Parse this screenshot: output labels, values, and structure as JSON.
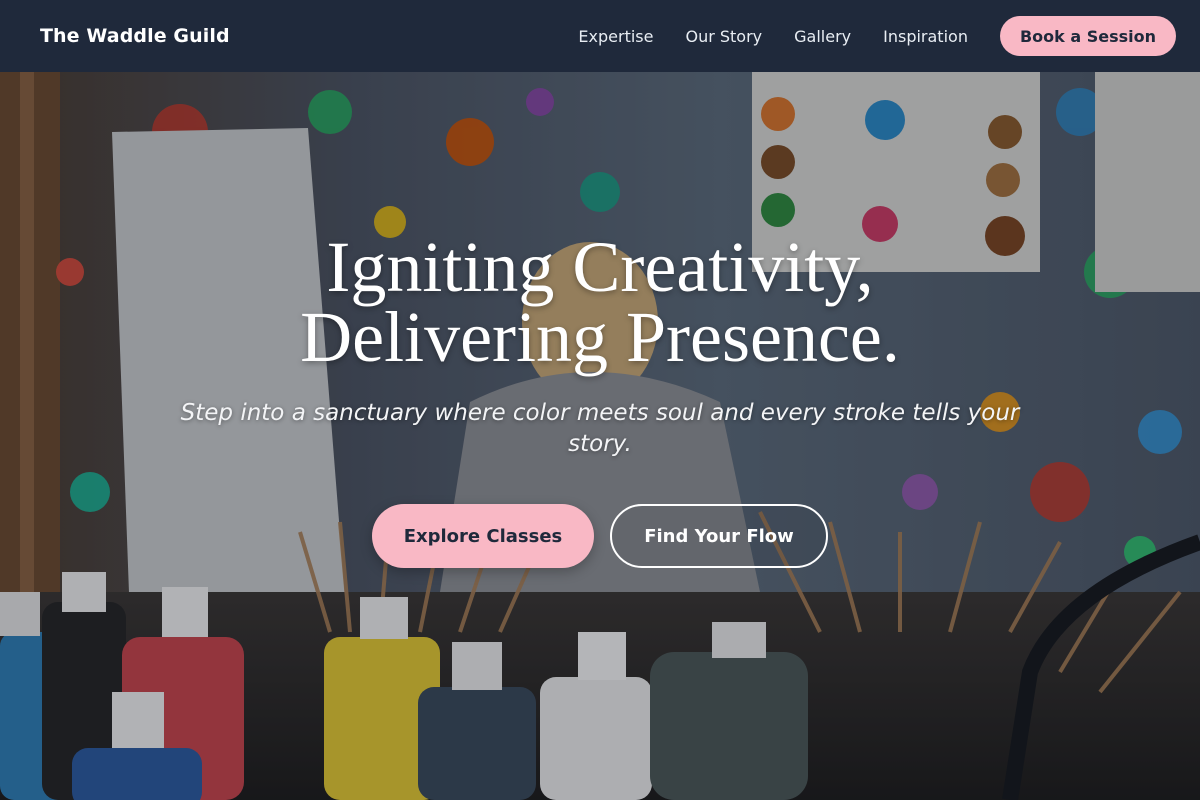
{
  "nav": {
    "brand": "The Waddle Guild",
    "links": [
      {
        "label": "Expertise"
      },
      {
        "label": "Our Story"
      },
      {
        "label": "Gallery"
      },
      {
        "label": "Inspiration"
      }
    ],
    "cta_label": "Book a Session"
  },
  "hero": {
    "title_line1": "Igniting Creativity,",
    "title_line2": "Delivering Presence.",
    "subtitle": "Step into a sanctuary where color meets soul and every stroke tells your story.",
    "primary_button": "Explore Classes",
    "secondary_button": "Find Your Flow",
    "background_image": "art-studio-paint-bottles-photo"
  },
  "colors": {
    "nav_background": "#1f293b",
    "accent_pink": "#f9b8c5",
    "text_dark": "#1f293b",
    "text_light": "#ffffff"
  }
}
